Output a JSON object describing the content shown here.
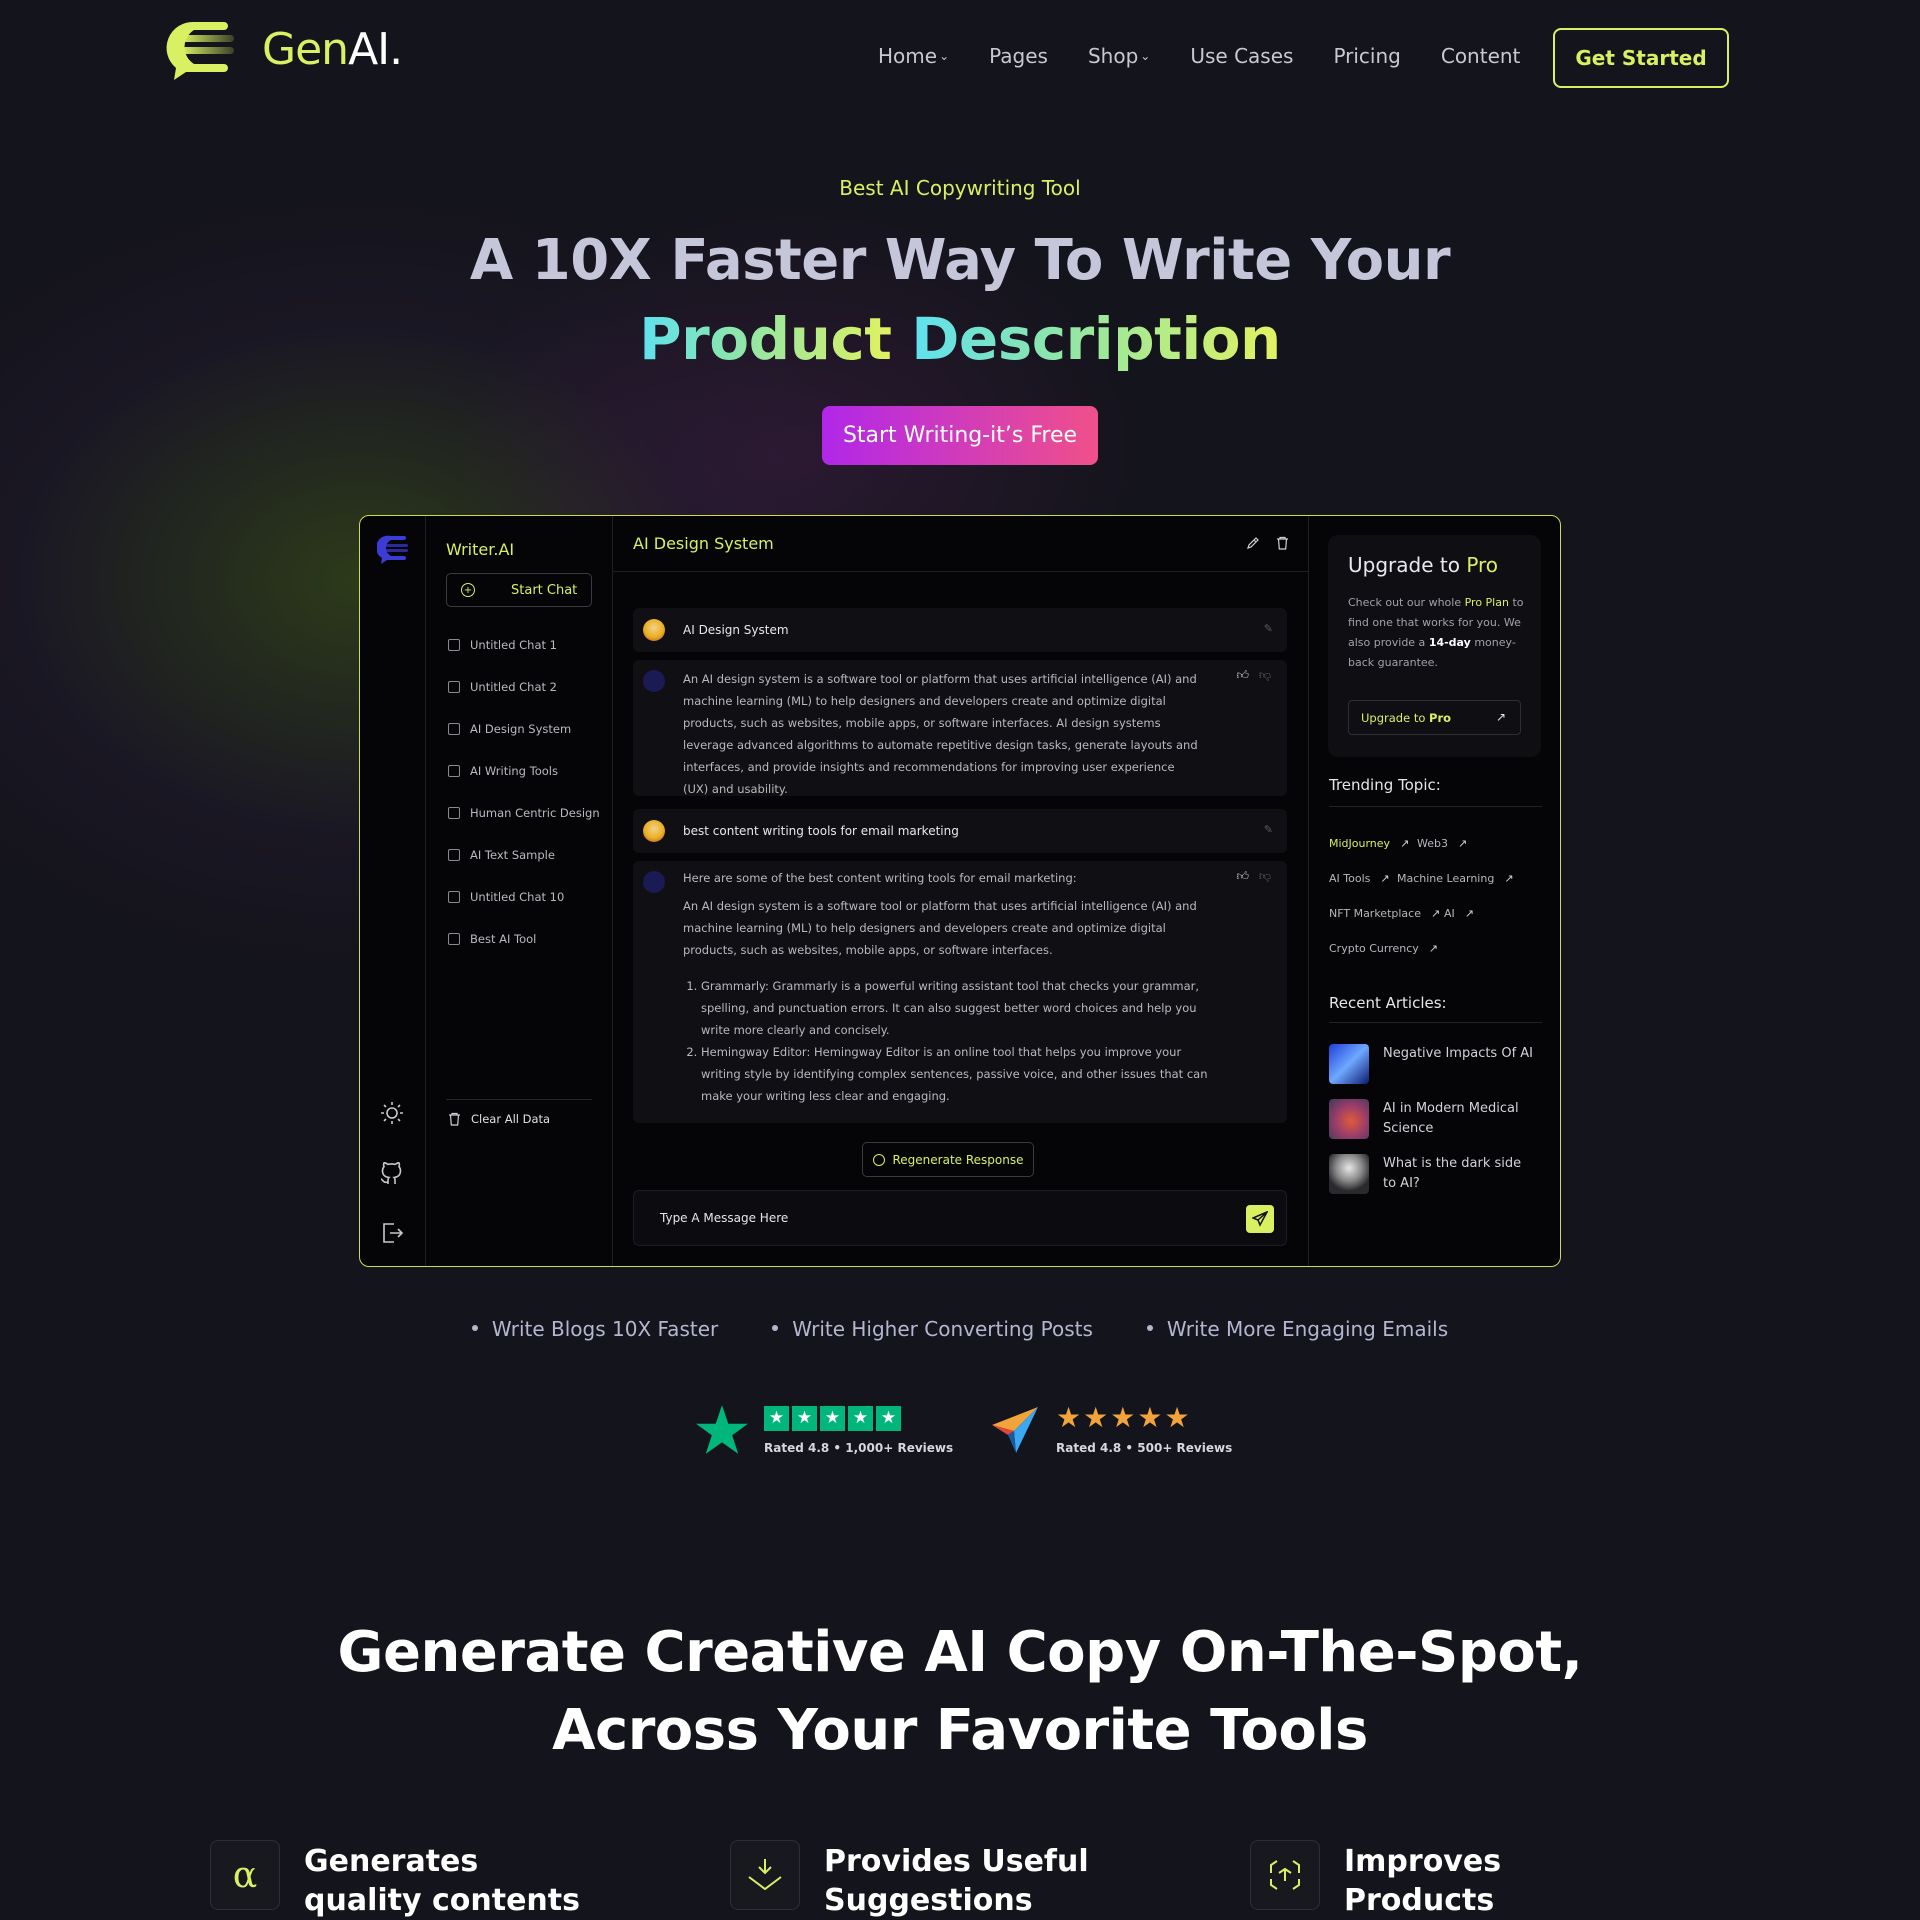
{
  "header": {
    "brand_prefix": "Gen",
    "brand_suffix": "AI.",
    "nav": [
      "Home",
      "Pages",
      "Shop",
      "Use Cases",
      "Pricing",
      "Content"
    ],
    "cta": "Get Started"
  },
  "hero": {
    "tagline": "Best AI Copywriting Tool",
    "title_line1": "A 10X Faster Way To Write Your",
    "title_word1": "Product",
    "title_word2": "Description",
    "cta": "Start Writing-it’s Free"
  },
  "app": {
    "brand": "Writer.AI",
    "start_chat": "Start Chat",
    "chats": [
      "Untitled Chat 1",
      "Untitled Chat 2",
      "AI Design System",
      "AI Writing Tools",
      "Human Centric Design",
      "AI Text Sample",
      "Untitled Chat 10",
      "Best AI Tool"
    ],
    "clear_all": "Clear All Data",
    "main_title": "AI Design System",
    "q1": "AI Design System",
    "a1": "An AI design system is a software tool or platform that uses artificial intelligence (AI) and machine learning (ML) to help designers and developers create and optimize digital products, such as websites, mobile apps, or software interfaces. AI design systems leverage advanced algorithms to automate repetitive design tasks, generate layouts and interfaces, and provide insights and recommendations for improving user experience (UX) and usability.",
    "q2": "best content writing tools for email marketing",
    "a2_intro": "Here are some of the best content writing tools for email marketing:",
    "a2_p": "An AI design system is a software tool or platform that uses artificial intelligence (AI) and machine learning (ML) to help designers and developers create and optimize digital products, such as websites, mobile apps, or software interfaces.",
    "a2_list": [
      "Grammarly: Grammarly is a powerful writing assistant tool that checks your grammar, spelling, and punctuation errors. It can also suggest better word choices and help you write more clearly and concisely.",
      "Hemingway Editor: Hemingway Editor is an online tool that helps you improve your writing style by identifying complex sentences, passive voice, and other issues that can make your writing less clear and engaging."
    ],
    "regenerate": "Regenerate Response",
    "message_placeholder": "Type A Message Here",
    "upgrade": {
      "title_a": "Upgrade to",
      "title_b": "Pro",
      "body_1": "Check out our whole",
      "body_link": "Pro Plan",
      "body_2": "to find one that works for you. We also provide a",
      "body_bold": "14-day",
      "body_3": "money-back guarantee.",
      "button_a": "Upgrade to",
      "button_b": "Pro"
    },
    "trending_label": "Trending Topic:",
    "trending": [
      "MidJourney",
      "Web3",
      "AI Tools",
      "Machine Learning",
      "NFT Marketplace",
      "AI",
      "Crypto Currency"
    ],
    "recent_label": "Recent Articles:",
    "articles": [
      "Negative Impacts Of AI",
      "AI in Modern Medical Science",
      "What is the dark side to AI?"
    ]
  },
  "bullets": [
    "Write Blogs 10X Faster",
    "Write Higher Converting Posts",
    "Write More Engaging Emails"
  ],
  "ratings": [
    {
      "text": "Rated 4.8 • 1,000+ Reviews",
      "stars": 5
    },
    {
      "text": "Rated 4.8 • 500+ Reviews",
      "stars": 5
    }
  ],
  "section2": {
    "title_line1": "Generate Creative AI Copy On-The-Spot,",
    "title_line2": "Across Your Favorite Tools",
    "features": [
      "Generates quality contents",
      "Provides Useful Suggestions",
      "Improves Products Productivity"
    ]
  },
  "colors": {
    "accent": "#d9f062",
    "background": "#14141c",
    "cta_gradient_start": "#b127e9",
    "cta_gradient_end": "#f0508a",
    "trustpilot": "#00b67a",
    "orange_stars": "#f2a33a"
  }
}
